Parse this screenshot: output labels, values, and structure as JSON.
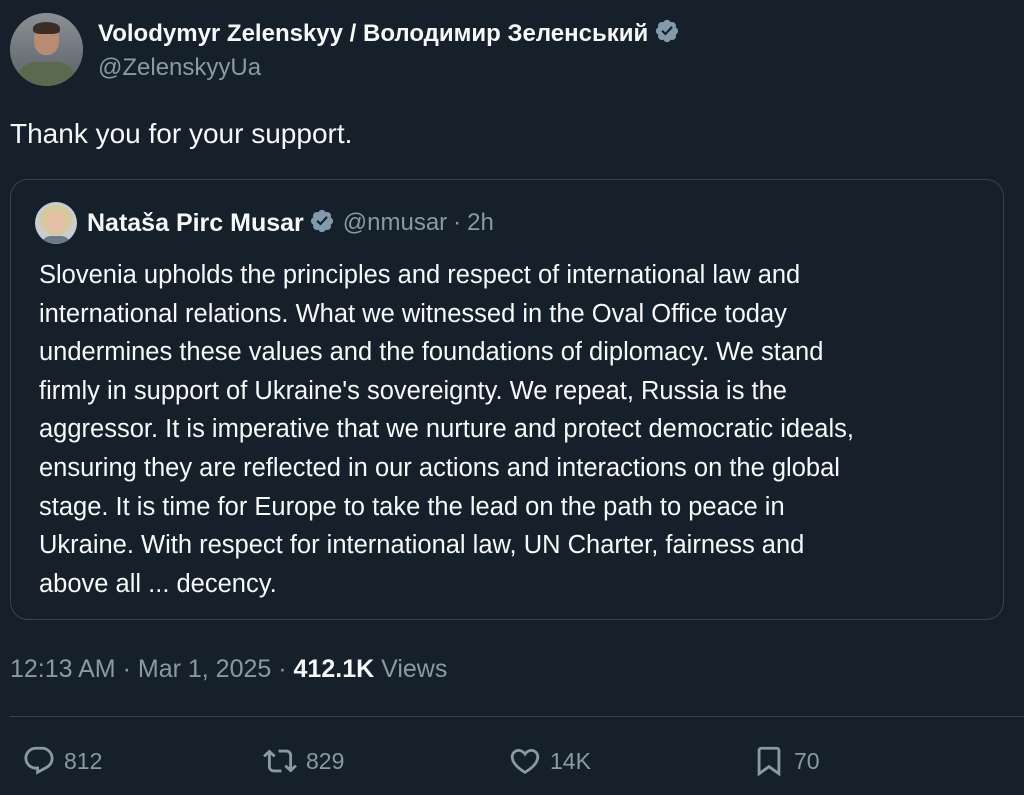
{
  "author": {
    "display_name": "Volodymyr Zelenskyy / Володимир Зеленський",
    "handle": "@ZelenskyyUa",
    "verified": true
  },
  "tweet": {
    "text": "Thank you for your support."
  },
  "quoted_tweet": {
    "display_name": "Nataša Pirc Musar",
    "handle": "@nmusar",
    "separator": "·",
    "time": "2h",
    "verified": true,
    "text": "Slovenia upholds the principles and respect of international law and\ninternational relations. What we witnessed in the Oval Office today\nundermines these values and the foundations of diplomacy. We stand\nfirmly in support of Ukraine's sovereignty. We repeat, Russia is the\naggressor. It is imperative that we nurture and protect democratic ideals,\nensuring they are reflected in our actions and interactions on the global\nstage. It is time for Europe to take the lead on the path to peace in\nUkraine. With respect for international law, UN Charter, fairness and\nabove all ... decency."
  },
  "meta": {
    "time": "12:13 AM",
    "sep1": "·",
    "date": "Mar 1, 2025",
    "sep2": "·",
    "views_count": "412.1K",
    "views_label": "Views"
  },
  "actions": {
    "replies": "812",
    "reposts": "829",
    "likes": "14K",
    "bookmarks": "70"
  },
  "colors": {
    "background": "#15202b",
    "text": "#f7f9f9",
    "muted": "#8b98a5",
    "border": "#38444d",
    "verified_badge": "#829aab"
  },
  "icons": [
    "verified-badge-icon",
    "reply-icon",
    "repost-icon",
    "like-icon",
    "bookmark-icon"
  ]
}
